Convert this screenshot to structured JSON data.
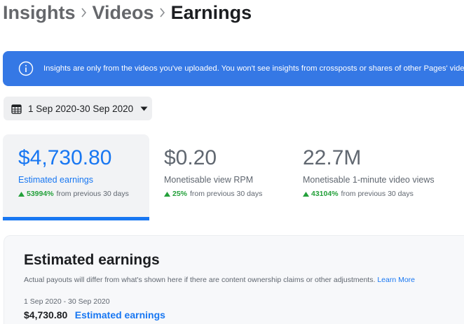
{
  "breadcrumb": {
    "items": [
      {
        "label": "Insights"
      },
      {
        "label": "Videos"
      },
      {
        "label": "Earnings"
      }
    ]
  },
  "banner": {
    "text": "Insights are only from the videos you've uploaded. You won't see insights from crossposts or shares of other Pages' videos."
  },
  "date_picker": {
    "label": "1 Sep 2020-30 Sep 2020"
  },
  "metrics": [
    {
      "value": "$4,730.80",
      "label": "Estimated earnings",
      "change": "53994%",
      "change_suffix": "from previous 30 days"
    },
    {
      "value": "$0.20",
      "label": "Monetisable view RPM",
      "change": "25%",
      "change_suffix": "from previous 30 days"
    },
    {
      "value": "22.7M",
      "label": "Monetisable 1-minute video views",
      "change": "43104%",
      "change_suffix": "from previous 30 days"
    }
  ],
  "earnings_card": {
    "title": "Estimated earnings",
    "note": "Actual payouts will differ from what's shown here if there are content ownership claims or other adjustments.",
    "learn_more": "Learn More",
    "date_range": "1 Sep 2020 - 30 Sep 2020",
    "total_amount": "$4,730.80",
    "total_label": "Estimated earnings"
  },
  "colors": {
    "accent": "#1877f2",
    "banner": "#3578e5",
    "positive": "#23a03a"
  }
}
